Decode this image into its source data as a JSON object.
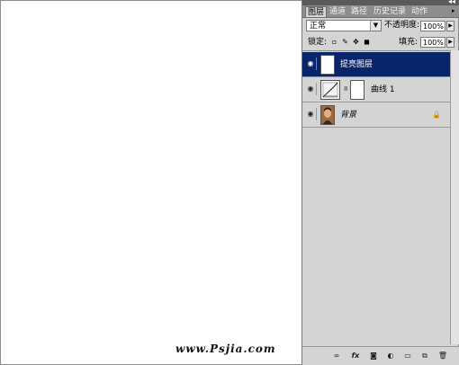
{
  "watermark": "www.Psjia.com",
  "panel": {
    "tabs": [
      "图层",
      "通道",
      "路径",
      "历史记录",
      "动作"
    ],
    "menu_icon": "panel-menu-arrow-icon",
    "collapse_icon": "double-arrow-icon",
    "blend_mode": "正常",
    "opacity_label": "不透明度:",
    "opacity_value": "100%",
    "lock_label": "锁定:",
    "fill_label": "填充:",
    "fill_value": "100%",
    "lock_icons": [
      "lock-transparent-icon",
      "lock-brush-icon",
      "lock-move-icon",
      "lock-all-icon"
    ],
    "layers": [
      {
        "name": "提亮图层",
        "selected": true,
        "visible": true,
        "type": "normal"
      },
      {
        "name": "曲线 1",
        "selected": false,
        "visible": true,
        "type": "adjustment"
      },
      {
        "name": "背景",
        "selected": false,
        "visible": true,
        "type": "background",
        "locked": true
      }
    ],
    "bottom_icons": [
      "link-layers-icon",
      "layer-style-icon",
      "add-mask-icon",
      "adjustment-layer-icon",
      "new-group-icon",
      "new-layer-icon",
      "delete-icon"
    ]
  }
}
